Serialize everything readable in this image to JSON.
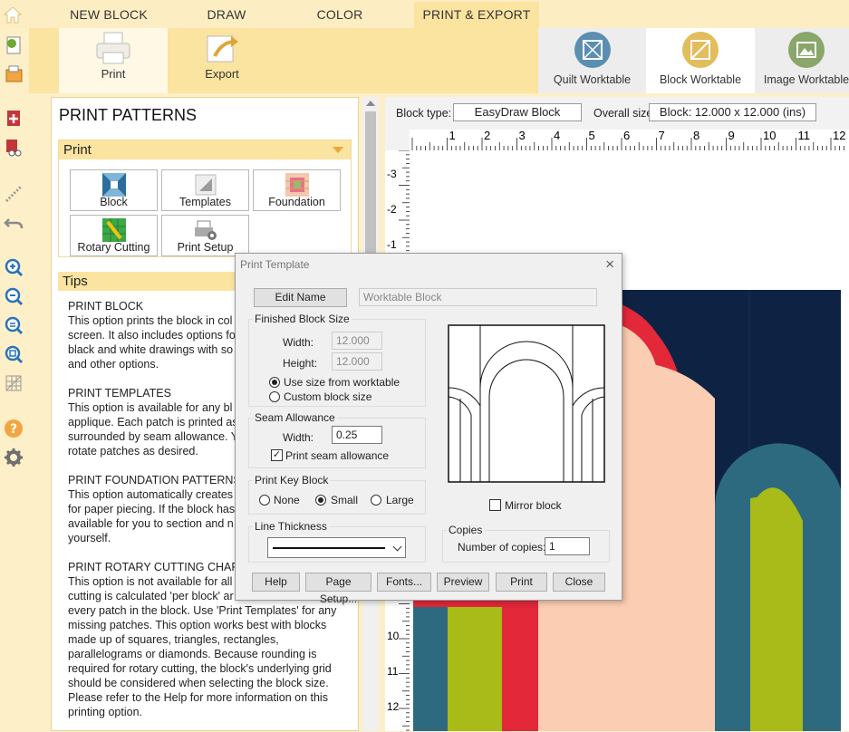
{
  "tabs": {
    "new_block": "NEW BLOCK",
    "draw": "DRAW",
    "color": "COLOR",
    "print_export": "PRINT & EXPORT"
  },
  "ribbon": {
    "print": "Print",
    "export": "Export",
    "quilt_worktable": "Quilt Worktable",
    "block_worktable": "Block Worktable",
    "image_worktable": "Image Worktable"
  },
  "panel": {
    "title": "PRINT PATTERNS",
    "print_section": "Print",
    "buttons": {
      "block": "Block",
      "templates": "Templates",
      "foundation": "Foundation",
      "rotary_cutting": "Rotary Cutting",
      "print_setup": "Print Setup"
    },
    "tips_section": "Tips",
    "tips": [
      {
        "heading": "PRINT BLOCK",
        "lines": [
          "This option prints the block in col",
          "screen. It also includes options fo",
          "black and white drawings with so",
          "and other options."
        ]
      },
      {
        "heading": "PRINT TEMPLATES",
        "lines": [
          "This option is available for any bl",
          "applique. Each patch is printed as",
          "surrounded by seam allowance. Y",
          "rotate patches as desired."
        ]
      },
      {
        "heading": "PRINT FOUNDATION PATTERNS",
        "lines": [
          "This option automatically creates",
          "for paper piecing. If the block has",
          "available for you to section and n",
          "yourself."
        ]
      },
      {
        "heading": "PRINT ROTARY CUTTING CHART",
        "lines": [
          "This option is not available for all",
          "cutting is calculated 'per block' ar",
          "every patch in the block. Use 'Print Templates' for any",
          "missing patches. This option works best with blocks",
          "made up of squares, triangles, rectangles,",
          "parallelograms or diamonds. Because rounding is",
          "required for rotary cutting, the block's underlying grid",
          "should be considered when selecting the block size.",
          "Please refer to the Help for more information on this",
          "printing option."
        ]
      }
    ]
  },
  "infobar": {
    "block_type_label": "Block type:",
    "block_type_value": "EasyDraw Block",
    "overall_size_label": "Overall size:",
    "overall_size_value": "Block: 12.000 x 12.000 (ins)"
  },
  "ruler": {
    "top": [
      "1",
      "2",
      "3",
      "4",
      "5",
      "6",
      "7",
      "8",
      "9",
      "10",
      "11",
      "12"
    ],
    "left": [
      "-3",
      "-2",
      "-1",
      "10",
      "11",
      "12"
    ]
  },
  "dialog": {
    "title": "Print Template",
    "edit_name": "Edit Name",
    "name_value": "Worktable Block",
    "finished_block_size": "Finished Block Size",
    "width_label": "Width:",
    "width_value": "12.000",
    "height_label": "Height:",
    "height_value": "12.000",
    "use_size": "Use size from worktable",
    "custom_size": "Custom block size",
    "seam_allowance": "Seam Allowance",
    "seam_width_label": "Width:",
    "seam_width_value": "0.25",
    "print_seam": "Print seam allowance",
    "print_key_block": "Print Key Block",
    "key_none": "None",
    "key_small": "Small",
    "key_large": "Large",
    "line_thickness": "Line Thickness",
    "mirror_block": "Mirror block",
    "copies": "Copies",
    "num_copies_label": "Number of copies:",
    "num_copies_value": "1",
    "buttons": {
      "help": "Help",
      "page_setup": "Page Setup...",
      "fonts": "Fonts...",
      "preview": "Preview",
      "print": "Print",
      "close": "Close"
    }
  },
  "colors": {
    "navy": "#0e2344",
    "red": "#e3283a",
    "peach": "#fbcdb3",
    "teal": "#2d6a80",
    "lime": "#a9bb18",
    "ribbon": "#fbe3a0",
    "tabbar": "#fdedc3"
  }
}
